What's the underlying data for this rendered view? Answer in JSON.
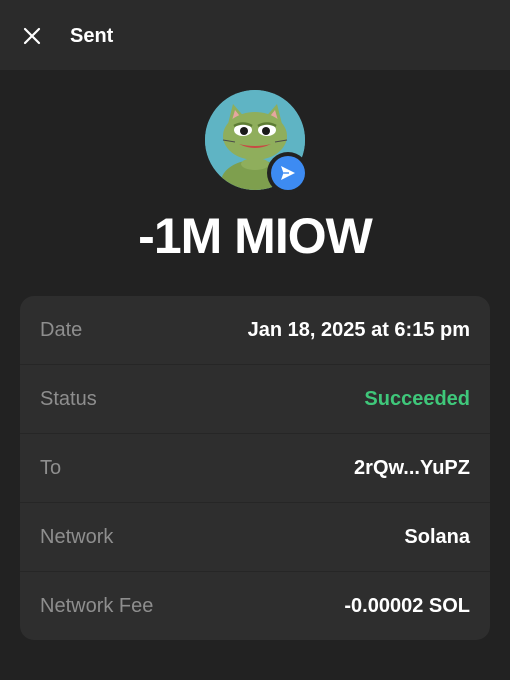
{
  "header": {
    "title": "Sent",
    "close_icon": "close-icon"
  },
  "token": {
    "amount": "-1M MIOW",
    "avatar_icon": "pepe-cat-token-avatar",
    "badge_icon": "send-arrow-icon",
    "badge_color": "#3d8bf2"
  },
  "details": [
    {
      "label": "Date",
      "value": "Jan 18, 2025 at 6:15 pm"
    },
    {
      "label": "Status",
      "value": "Succeeded",
      "color": "#3fc77a"
    },
    {
      "label": "To",
      "value": "2rQw...YuPZ"
    },
    {
      "label": "Network",
      "value": "Solana"
    },
    {
      "label": "Network Fee",
      "value": "-0.00002 SOL"
    }
  ]
}
